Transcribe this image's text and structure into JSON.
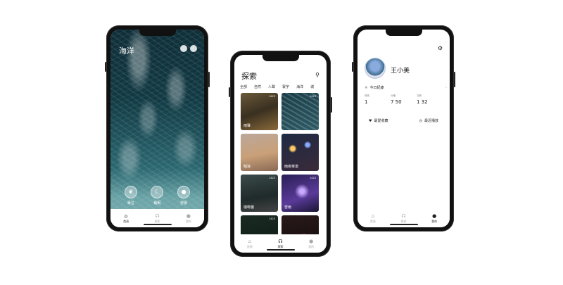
{
  "phone1": {
    "title": "海洋",
    "modes": [
      {
        "icon": "leaf-icon",
        "glyph": "❦",
        "label": "專注"
      },
      {
        "icon": "moon-icon",
        "glyph": "☾",
        "label": "睡眠"
      },
      {
        "icon": "drop-icon",
        "glyph": "●",
        "label": "舒壓"
      }
    ],
    "tabs": [
      {
        "icon": "home-icon",
        "label": "首頁",
        "active": true
      },
      {
        "icon": "headphones-icon",
        "label": "探索",
        "active": false
      },
      {
        "icon": "user-icon",
        "label": "我的",
        "active": false
      }
    ]
  },
  "phone2": {
    "title": "探索",
    "categories": [
      "全部",
      "自然",
      "人聲",
      "寰宇",
      "海洋",
      "城"
    ],
    "tiles": [
      {
        "name": "雨聲",
        "meta": "1423"
      },
      {
        "name": "",
        "meta": "1423"
      },
      {
        "name": "稻浪",
        "meta": ""
      },
      {
        "name": "雨夜車道",
        "meta": ""
      },
      {
        "name": "咖啡廳",
        "meta": "1423"
      },
      {
        "name": "雷雨",
        "meta": "1423"
      },
      {
        "name": "",
        "meta": "1423"
      },
      {
        "name": "",
        "meta": ""
      }
    ],
    "tabs": [
      {
        "icon": "home-icon",
        "label": "首頁",
        "active": false
      },
      {
        "icon": "headphones-icon",
        "label": "探索",
        "active": true
      },
      {
        "icon": "user-icon",
        "label": "我的",
        "active": false
      }
    ]
  },
  "phone3": {
    "username": "王小美",
    "daily_label": "今日紀錄",
    "stats": [
      {
        "label": "時長",
        "value": "1"
      },
      {
        "label": "分鐘",
        "value": "7  50"
      },
      {
        "label": "次數",
        "value": "1  32"
      }
    ],
    "links": [
      {
        "icon": "heart-icon",
        "label": "最愛收藏"
      },
      {
        "icon": "clock-icon",
        "label": "最近播放"
      }
    ],
    "tabs": [
      {
        "icon": "home-icon",
        "label": "首頁",
        "active": false
      },
      {
        "icon": "headphones-icon",
        "label": "探索",
        "active": false
      },
      {
        "icon": "user-icon",
        "label": "我的",
        "active": true
      }
    ]
  }
}
